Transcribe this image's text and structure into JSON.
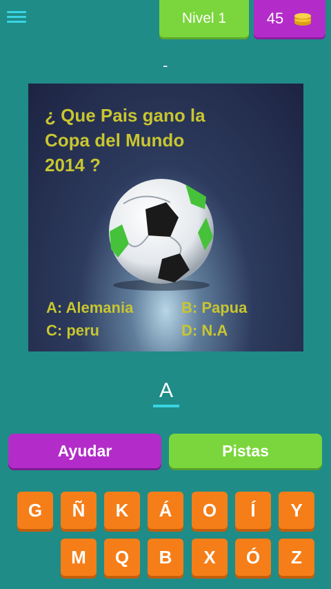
{
  "header": {
    "level_label": "Nivel 1",
    "coins": "45",
    "progress_text": "-"
  },
  "quiz": {
    "question": "¿ Que Pais gano la\nCopa del Mundo\n2014 ?",
    "options": {
      "a": "A: Alemania",
      "b": "B: Papua",
      "c": "C: peru",
      "d": "D: N.A"
    }
  },
  "answer": {
    "letters": [
      "A"
    ]
  },
  "buttons": {
    "help": "Ayudar",
    "hints": "Pistas"
  },
  "keyboard": {
    "row1": [
      "G",
      "Ñ",
      "K",
      "Á",
      "O",
      "Í",
      "Y"
    ],
    "row2": [
      "M",
      "Q",
      "B",
      "X",
      "Ó",
      "Z"
    ]
  },
  "colors": {
    "background": "#1f8c87",
    "purple": "#b32cc9",
    "green": "#7ad63c",
    "key_orange": "#f57e19",
    "accent_cyan": "#39d4e3"
  },
  "icons": {
    "menu": "hamburger-menu-icon",
    "coins": "coin-stack-icon"
  }
}
